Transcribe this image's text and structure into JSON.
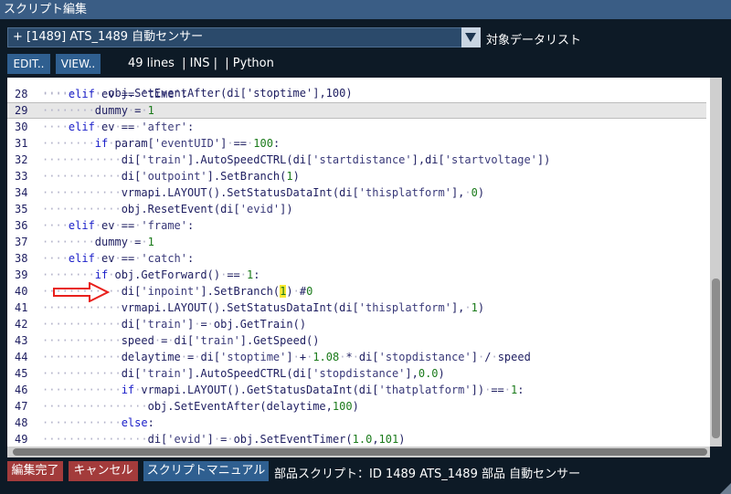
{
  "window": {
    "title": "スクリプト編集"
  },
  "object_select": {
    "value": "+ [1489] ATS_1489 自動センサー",
    "list_label": "対象データリスト"
  },
  "toolbar": {
    "edit_label": "EDIT..",
    "view_label": "VIEW..",
    "status": "49 lines  | INS |  | Python"
  },
  "footer": {
    "done_label": "編集完了",
    "cancel_label": "キャンセル",
    "manual_label": "スクリプトマニュアル",
    "info": "部品スクリプト：ID 1489 ATS_1489 部品 自動センサー"
  },
  "colors": {
    "accent": "#3a5d85",
    "highlight": "#f6e733",
    "arrow": "#e8201c"
  },
  "editor": {
    "current_line": "29",
    "lines": [
      {
        "n": "28",
        "indent": 1,
        "code": "elif ev == 'time':"
      },
      {
        "n": "29",
        "indent": 2,
        "code": "dummy = 1"
      },
      {
        "n": "30",
        "indent": 1,
        "code": "elif ev == 'after':"
      },
      {
        "n": "31",
        "indent": 2,
        "code": "if param['eventUID'] == 100:"
      },
      {
        "n": "32",
        "indent": 3,
        "code": "di['train'].AutoSpeedCTRL(di['startdistance'],di['startvoltage'])"
      },
      {
        "n": "33",
        "indent": 3,
        "code": "di['outpoint'].SetBranch(1)"
      },
      {
        "n": "34",
        "indent": 3,
        "code": "vrmapi.LAYOUT().SetStatusDataInt(di['thisplatform'], 0)"
      },
      {
        "n": "35",
        "indent": 3,
        "code": "obj.ResetEvent(di['evid'])"
      },
      {
        "n": "36",
        "indent": 1,
        "code": "elif ev == 'frame':"
      },
      {
        "n": "37",
        "indent": 2,
        "code": "dummy = 1"
      },
      {
        "n": "38",
        "indent": 1,
        "code": "elif ev == 'catch':"
      },
      {
        "n": "39",
        "indent": 2,
        "code": "if obj.GetForward() == 1:"
      },
      {
        "n": "40",
        "indent": 3,
        "code": "di['inpoint'].SetBranch(1) #0"
      },
      {
        "n": "41",
        "indent": 3,
        "code": "vrmapi.LAYOUT().SetStatusDataInt(di['thisplatform'], 1)"
      },
      {
        "n": "42",
        "indent": 3,
        "code": "di['train'] = obj.GetTrain()"
      },
      {
        "n": "43",
        "indent": 3,
        "code": "speed = di['train'].GetSpeed()"
      },
      {
        "n": "44",
        "indent": 3,
        "code": "delaytime = di['stoptime'] + 1.08 * di['stopdistance'] / speed"
      },
      {
        "n": "45",
        "indent": 3,
        "code": "di['train'].AutoSpeedCTRL(di['stopdistance'],0.0)"
      },
      {
        "n": "46",
        "indent": 3,
        "code": "if vrmapi.LAYOUT().GetStatusDataInt(di['thatplatform']) == 1:"
      },
      {
        "n": "47",
        "indent": 4,
        "code": "obj.SetEventAfter(delaytime,100)"
      },
      {
        "n": "48",
        "indent": 3,
        "code": "else:"
      },
      {
        "n": "49",
        "indent": 4,
        "code": "di['evid'] = obj.SetEventTimer(1.0,101)"
      }
    ],
    "partial_top_line": "obj.SetEventAfter(di['stoptime'],100)"
  }
}
